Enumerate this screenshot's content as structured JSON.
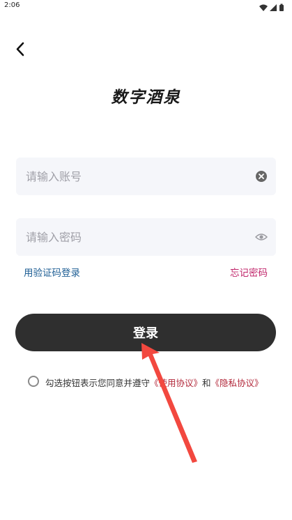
{
  "status_bar": {
    "time": "2:06"
  },
  "title": "数字酒泉",
  "account": {
    "placeholder": "请输入账号",
    "value": ""
  },
  "password": {
    "placeholder": "请输入密码",
    "value": ""
  },
  "links": {
    "sms_login": "用验证码登录",
    "forgot_password": "忘记密码"
  },
  "login_button": "登录",
  "agreement": {
    "prefix": "勾选按钮表示您同意并遵守",
    "terms": "《使用协议》",
    "and": "和",
    "privacy": "《隐私协议》",
    "checked": false
  },
  "colors": {
    "link_blue": "#1f5f95",
    "link_red": "#c0246a",
    "agreement_link": "#b2283a",
    "button_dark": "#2f2f2f",
    "field_bg": "#f5f6fa",
    "arrow": "#f2483f"
  }
}
